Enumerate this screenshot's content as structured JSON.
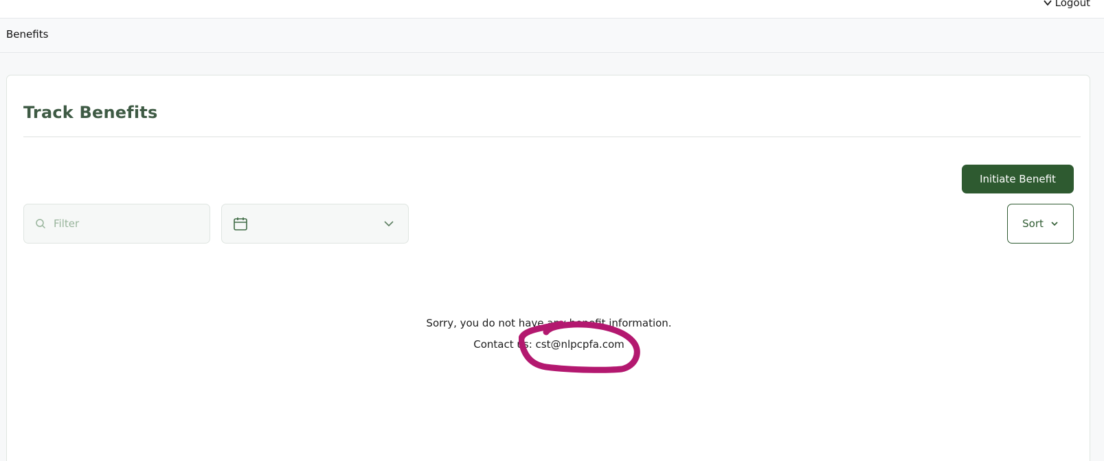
{
  "header": {
    "logout_label": "Logout"
  },
  "subheader": {
    "title": "Benefits"
  },
  "card": {
    "title": "Track Benefits",
    "initiate_button": "Initiate Benefit",
    "filter_placeholder": "Filter",
    "sort_label": "Sort",
    "empty_message": "Sorry, you do not have any benefit information.",
    "contact_prefix": "Contact us:",
    "contact_email": "cst@nlpcpfa.com"
  },
  "colors": {
    "brand_green": "#2e5a30",
    "title_green": "#3e5a44",
    "placeholder_green": "#98b49b",
    "annotation_magenta": "#b3186f"
  },
  "icons": {
    "logout": "chevron-down-icon",
    "filter": "search-icon",
    "date": "calendar-icon",
    "date_toggle": "chevron-down-icon",
    "sort": "chevron-down-icon"
  }
}
